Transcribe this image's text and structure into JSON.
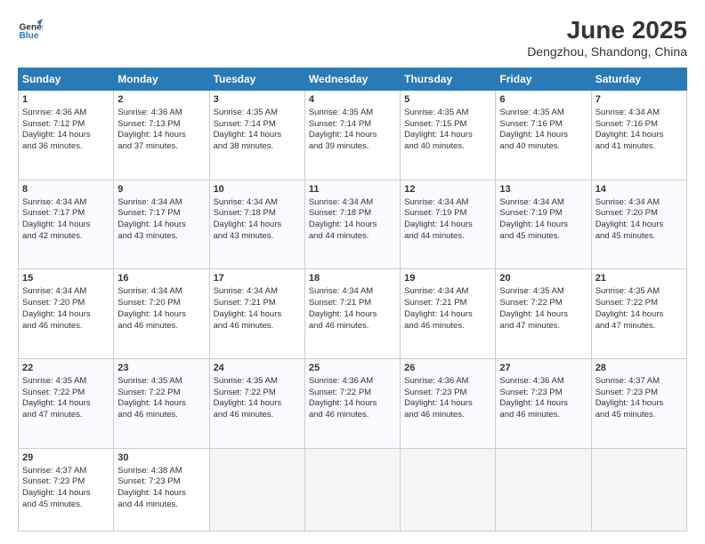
{
  "header": {
    "logo_line1": "General",
    "logo_line2": "Blue",
    "title": "June 2025",
    "subtitle": "Dengzhou, Shandong, China"
  },
  "weekdays": [
    "Sunday",
    "Monday",
    "Tuesday",
    "Wednesday",
    "Thursday",
    "Friday",
    "Saturday"
  ],
  "weeks": [
    [
      {
        "day": "1",
        "sr": "4:36 AM",
        "ss": "7:12 PM",
        "dl": "14 hours and 36 minutes."
      },
      {
        "day": "2",
        "sr": "4:36 AM",
        "ss": "7:13 PM",
        "dl": "14 hours and 37 minutes."
      },
      {
        "day": "3",
        "sr": "4:35 AM",
        "ss": "7:14 PM",
        "dl": "14 hours and 38 minutes."
      },
      {
        "day": "4",
        "sr": "4:35 AM",
        "ss": "7:14 PM",
        "dl": "14 hours and 39 minutes."
      },
      {
        "day": "5",
        "sr": "4:35 AM",
        "ss": "7:15 PM",
        "dl": "14 hours and 40 minutes."
      },
      {
        "day": "6",
        "sr": "4:35 AM",
        "ss": "7:16 PM",
        "dl": "14 hours and 40 minutes."
      },
      {
        "day": "7",
        "sr": "4:34 AM",
        "ss": "7:16 PM",
        "dl": "14 hours and 41 minutes."
      }
    ],
    [
      {
        "day": "8",
        "sr": "4:34 AM",
        "ss": "7:17 PM",
        "dl": "14 hours and 42 minutes."
      },
      {
        "day": "9",
        "sr": "4:34 AM",
        "ss": "7:17 PM",
        "dl": "14 hours and 43 minutes."
      },
      {
        "day": "10",
        "sr": "4:34 AM",
        "ss": "7:18 PM",
        "dl": "14 hours and 43 minutes."
      },
      {
        "day": "11",
        "sr": "4:34 AM",
        "ss": "7:18 PM",
        "dl": "14 hours and 44 minutes."
      },
      {
        "day": "12",
        "sr": "4:34 AM",
        "ss": "7:19 PM",
        "dl": "14 hours and 44 minutes."
      },
      {
        "day": "13",
        "sr": "4:34 AM",
        "ss": "7:19 PM",
        "dl": "14 hours and 45 minutes."
      },
      {
        "day": "14",
        "sr": "4:34 AM",
        "ss": "7:20 PM",
        "dl": "14 hours and 45 minutes."
      }
    ],
    [
      {
        "day": "15",
        "sr": "4:34 AM",
        "ss": "7:20 PM",
        "dl": "14 hours and 46 minutes."
      },
      {
        "day": "16",
        "sr": "4:34 AM",
        "ss": "7:20 PM",
        "dl": "14 hours and 46 minutes."
      },
      {
        "day": "17",
        "sr": "4:34 AM",
        "ss": "7:21 PM",
        "dl": "14 hours and 46 minutes."
      },
      {
        "day": "18",
        "sr": "4:34 AM",
        "ss": "7:21 PM",
        "dl": "14 hours and 46 minutes."
      },
      {
        "day": "19",
        "sr": "4:34 AM",
        "ss": "7:21 PM",
        "dl": "14 hours and 46 minutes."
      },
      {
        "day": "20",
        "sr": "4:35 AM",
        "ss": "7:22 PM",
        "dl": "14 hours and 47 minutes."
      },
      {
        "day": "21",
        "sr": "4:35 AM",
        "ss": "7:22 PM",
        "dl": "14 hours and 47 minutes."
      }
    ],
    [
      {
        "day": "22",
        "sr": "4:35 AM",
        "ss": "7:22 PM",
        "dl": "14 hours and 47 minutes."
      },
      {
        "day": "23",
        "sr": "4:35 AM",
        "ss": "7:22 PM",
        "dl": "14 hours and 46 minutes."
      },
      {
        "day": "24",
        "sr": "4:35 AM",
        "ss": "7:22 PM",
        "dl": "14 hours and 46 minutes."
      },
      {
        "day": "25",
        "sr": "4:36 AM",
        "ss": "7:22 PM",
        "dl": "14 hours and 46 minutes."
      },
      {
        "day": "26",
        "sr": "4:36 AM",
        "ss": "7:23 PM",
        "dl": "14 hours and 46 minutes."
      },
      {
        "day": "27",
        "sr": "4:36 AM",
        "ss": "7:23 PM",
        "dl": "14 hours and 46 minutes."
      },
      {
        "day": "28",
        "sr": "4:37 AM",
        "ss": "7:23 PM",
        "dl": "14 hours and 45 minutes."
      }
    ],
    [
      {
        "day": "29",
        "sr": "4:37 AM",
        "ss": "7:23 PM",
        "dl": "14 hours and 45 minutes."
      },
      {
        "day": "30",
        "sr": "4:38 AM",
        "ss": "7:23 PM",
        "dl": "14 hours and 44 minutes."
      },
      null,
      null,
      null,
      null,
      null
    ]
  ],
  "labels": {
    "sunrise": "Sunrise:",
    "sunset": "Sunset:",
    "daylight": "Daylight:"
  }
}
